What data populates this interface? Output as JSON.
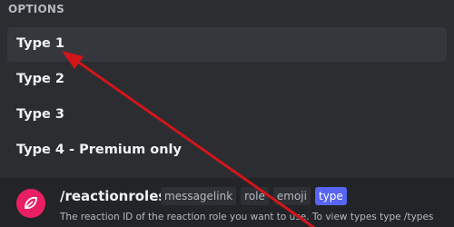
{
  "options": {
    "header": "OPTIONS",
    "items": [
      {
        "label": "Type 1"
      },
      {
        "label": "Type 2"
      },
      {
        "label": "Type 3"
      },
      {
        "label": "Type 4 - Premium only"
      }
    ]
  },
  "command": {
    "name": "/reactionroles",
    "params": [
      "messagelink",
      "role",
      "emoji",
      "type"
    ],
    "active_param": "type",
    "description": "The reaction ID of the reaction role you want to use. To view types type /types"
  },
  "colors": {
    "background": "#2b2d31",
    "hover": "#35373c",
    "accent": "#5865f2",
    "annotation_arrow": "#d0161b",
    "avatar": "#e91e63"
  },
  "icons": {
    "avatar": "reaction-roles-app-icon",
    "annotation": "red-arrow-annotation"
  }
}
